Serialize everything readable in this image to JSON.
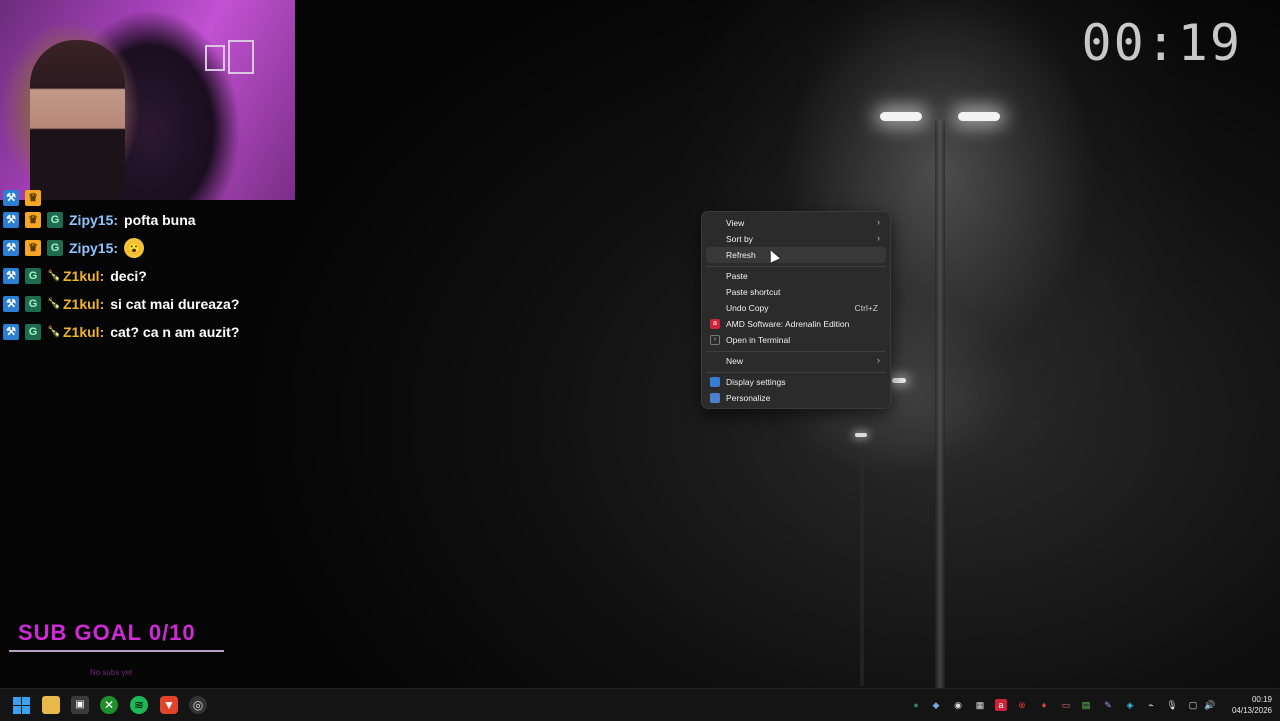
{
  "timer": "00:19",
  "chat": {
    "messages": [
      {
        "user": "Zipy15:",
        "text": "pofta buna",
        "user_color": "#8ec5ff"
      },
      {
        "user": "Zipy15:",
        "text": "",
        "emote": "😮",
        "user_color": "#8ec5ff"
      },
      {
        "user": "Z1kul:",
        "text": "deci?",
        "user_color": "#f0b429"
      },
      {
        "user": "Z1kul:",
        "text": "si cat mai dureaza?",
        "user_color": "#f0b429"
      },
      {
        "user": "Z1kul:",
        "text": "cat? ca n am auzit?",
        "user_color": "#f0b429"
      }
    ]
  },
  "sub_goal": {
    "label": "SUB GOAL 0/10",
    "progress": 0,
    "note": "No subs yet"
  },
  "context_menu": {
    "items": [
      {
        "label": "View",
        "submenu": true
      },
      {
        "label": "Sort by",
        "submenu": true
      },
      {
        "label": "Refresh"
      },
      {
        "label": "Paste"
      },
      {
        "label": "Paste shortcut"
      },
      {
        "label": "Undo Copy",
        "shortcut": "Ctrl+Z"
      },
      {
        "label": "AMD Software: Adrenalin Edition",
        "icon": "amd-icon"
      },
      {
        "label": "Open in Terminal",
        "icon": "terminal-icon"
      },
      {
        "label": "New",
        "submenu": true
      },
      {
        "label": "Display settings",
        "icon": "display-icon"
      },
      {
        "label": "Personalize",
        "icon": "personalize-icon"
      }
    ]
  },
  "taskbar": {
    "apps": [
      "start-icon",
      "file-explorer-icon",
      "store-icon",
      "xbox-icon",
      "spotify-icon",
      "brave-icon",
      "obs-icon"
    ],
    "clock_time": "00:19",
    "clock_date": "04/13/2026"
  },
  "colors": {
    "accent_pink": "#d02ad6",
    "menu_bg": "#2b2b2b",
    "taskbar_bg": "#141414"
  }
}
